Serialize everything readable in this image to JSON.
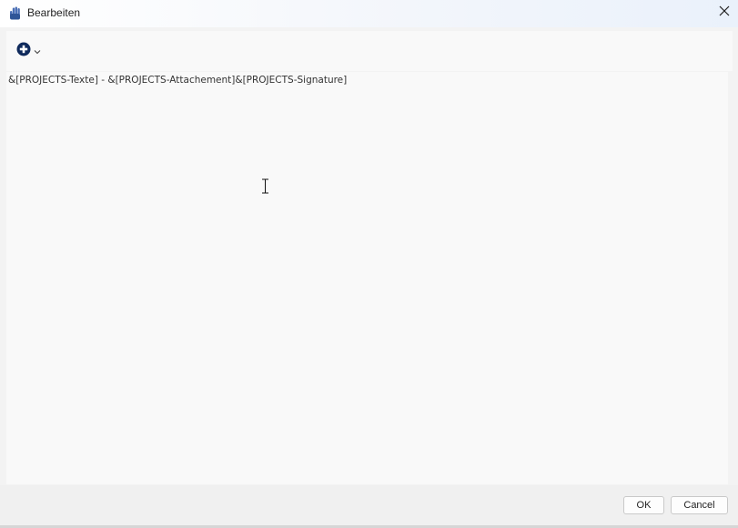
{
  "window": {
    "title": "Bearbeiten"
  },
  "icons": {
    "app": "app-hand-icon",
    "close": "close-icon",
    "add": "add-circle-icon",
    "chevron": "chevron-down-icon",
    "cursor": "text-cursor-icon"
  },
  "colors": {
    "accent": "#0f2a5c",
    "app_icon": "#4a6fb5"
  },
  "editor": {
    "content": "&[PROJECTS-Texte] - &[PROJECTS-Attachement]&[PROJECTS-Signature]"
  },
  "footer": {
    "ok_label": "OK",
    "cancel_label": "Cancel"
  }
}
